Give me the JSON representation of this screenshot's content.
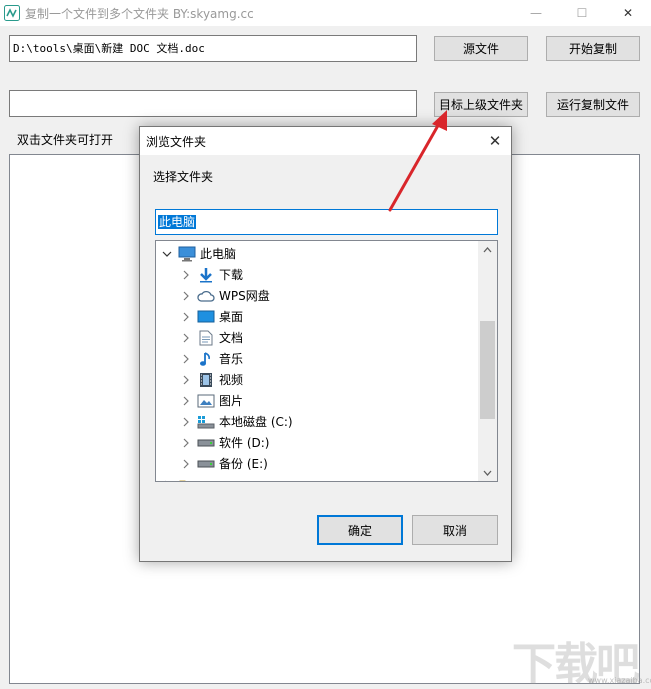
{
  "window": {
    "title": "复制一个文件到多个文件夹   BY:skyamg.cc",
    "min_glyph": "—",
    "max_glyph": "☐",
    "close_glyph": "✕"
  },
  "main": {
    "source_path": "D:\\tools\\桌面\\新建 DOC 文档.doc",
    "target_path": "",
    "source_button": "源文件",
    "start_button": "开始复制",
    "target_button": "目标上级文件夹",
    "run_button": "运行复制文件",
    "hint_label": "双击文件夹可打开"
  },
  "dialog": {
    "title": "浏览文件夹",
    "close_glyph": "✕",
    "prompt": "选择文件夹",
    "input_value": "此电脑",
    "ok_button": "确定",
    "cancel_button": "取消",
    "tree": [
      {
        "label": "此电脑",
        "icon": "computer-icon",
        "expanded": true
      },
      {
        "label": "下载",
        "icon": "download-icon"
      },
      {
        "label": "WPS网盘",
        "icon": "cloud-icon"
      },
      {
        "label": "桌面",
        "icon": "desktop-icon"
      },
      {
        "label": "文档",
        "icon": "document-icon"
      },
      {
        "label": "音乐",
        "icon": "music-icon"
      },
      {
        "label": "视频",
        "icon": "video-icon"
      },
      {
        "label": "图片",
        "icon": "picture-icon"
      },
      {
        "label": "本地磁盘 (C:)",
        "icon": "windows-drive-icon"
      },
      {
        "label": "软件 (D:)",
        "icon": "drive-icon"
      },
      {
        "label": "备份 (E:)",
        "icon": "drive-icon"
      }
    ]
  },
  "colors": {
    "accent": "#0078d7",
    "arrow": "#d9262b",
    "title_gray": "#999999"
  },
  "watermark": {
    "text": "下载吧",
    "url": "www.xiazaiba.com"
  }
}
